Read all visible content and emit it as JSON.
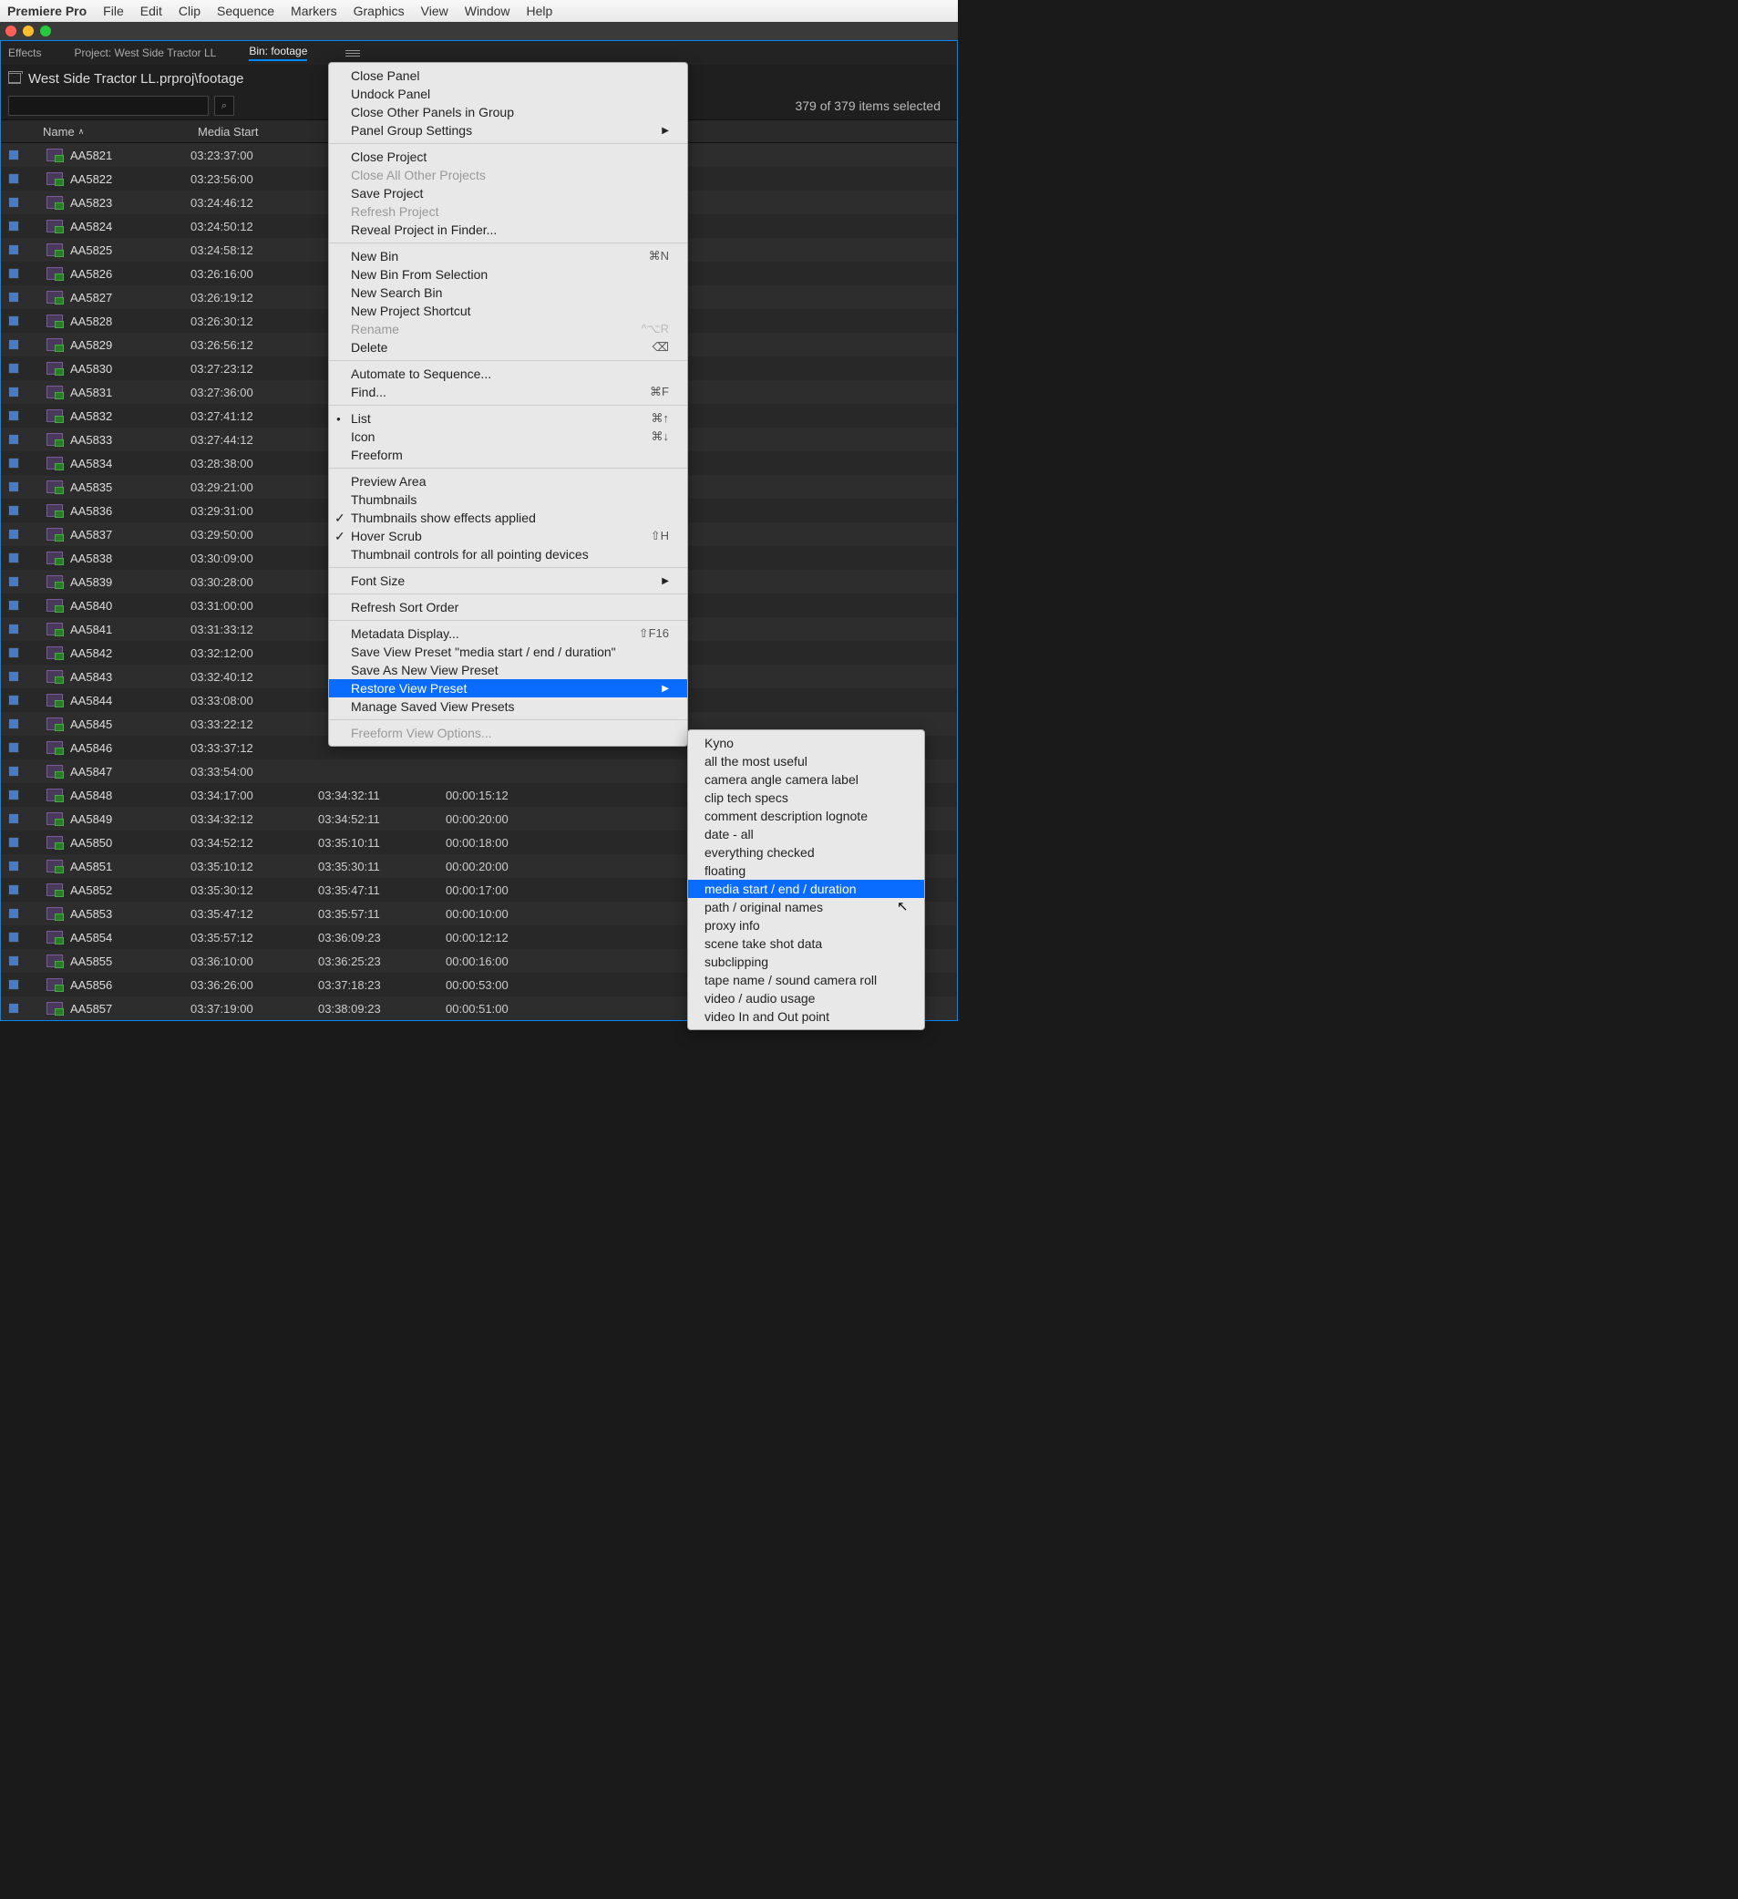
{
  "menubar": {
    "app": "Premiere Pro",
    "items": [
      "File",
      "Edit",
      "Clip",
      "Sequence",
      "Markers",
      "Graphics",
      "View",
      "Window",
      "Help"
    ]
  },
  "panelTabs": {
    "effects": "Effects",
    "project": "Project: West Side Tractor LL",
    "bin": "Bin: footage"
  },
  "breadcrumb": "West Side Tractor LL.prproj\\footage",
  "selectionCount": "379 of 379 items selected",
  "columns": {
    "name": "Name",
    "mediaStart": "Media Start"
  },
  "clips": [
    {
      "name": "AA5821",
      "ms": "03:23:37:00",
      "me": "",
      "md": ""
    },
    {
      "name": "AA5822",
      "ms": "03:23:56:00",
      "me": "",
      "md": ""
    },
    {
      "name": "AA5823",
      "ms": "03:24:46:12",
      "me": "",
      "md": ""
    },
    {
      "name": "AA5824",
      "ms": "03:24:50:12",
      "me": "",
      "md": ""
    },
    {
      "name": "AA5825",
      "ms": "03:24:58:12",
      "me": "",
      "md": ""
    },
    {
      "name": "AA5826",
      "ms": "03:26:16:00",
      "me": "",
      "md": ""
    },
    {
      "name": "AA5827",
      "ms": "03:26:19:12",
      "me": "",
      "md": ""
    },
    {
      "name": "AA5828",
      "ms": "03:26:30:12",
      "me": "",
      "md": ""
    },
    {
      "name": "AA5829",
      "ms": "03:26:56:12",
      "me": "",
      "md": ""
    },
    {
      "name": "AA5830",
      "ms": "03:27:23:12",
      "me": "",
      "md": ""
    },
    {
      "name": "AA5831",
      "ms": "03:27:36:00",
      "me": "",
      "md": ""
    },
    {
      "name": "AA5832",
      "ms": "03:27:41:12",
      "me": "",
      "md": ""
    },
    {
      "name": "AA5833",
      "ms": "03:27:44:12",
      "me": "",
      "md": ""
    },
    {
      "name": "AA5834",
      "ms": "03:28:38:00",
      "me": "",
      "md": ""
    },
    {
      "name": "AA5835",
      "ms": "03:29:21:00",
      "me": "",
      "md": ""
    },
    {
      "name": "AA5836",
      "ms": "03:29:31:00",
      "me": "",
      "md": ""
    },
    {
      "name": "AA5837",
      "ms": "03:29:50:00",
      "me": "",
      "md": ""
    },
    {
      "name": "AA5838",
      "ms": "03:30:09:00",
      "me": "",
      "md": ""
    },
    {
      "name": "AA5839",
      "ms": "03:30:28:00",
      "me": "",
      "md": ""
    },
    {
      "name": "AA5840",
      "ms": "03:31:00:00",
      "me": "",
      "md": ""
    },
    {
      "name": "AA5841",
      "ms": "03:31:33:12",
      "me": "",
      "md": ""
    },
    {
      "name": "AA5842",
      "ms": "03:32:12:00",
      "me": "",
      "md": ""
    },
    {
      "name": "AA5843",
      "ms": "03:32:40:12",
      "me": "",
      "md": ""
    },
    {
      "name": "AA5844",
      "ms": "03:33:08:00",
      "me": "",
      "md": ""
    },
    {
      "name": "AA5845",
      "ms": "03:33:22:12",
      "me": "",
      "md": ""
    },
    {
      "name": "AA5846",
      "ms": "03:33:37:12",
      "me": "",
      "md": ""
    },
    {
      "name": "AA5847",
      "ms": "03:33:54:00",
      "me": "",
      "md": ""
    },
    {
      "name": "AA5848",
      "ms": "03:34:17:00",
      "me": "03:34:32:11",
      "md": "00:00:15:12"
    },
    {
      "name": "AA5849",
      "ms": "03:34:32:12",
      "me": "03:34:52:11",
      "md": "00:00:20:00"
    },
    {
      "name": "AA5850",
      "ms": "03:34:52:12",
      "me": "03:35:10:11",
      "md": "00:00:18:00"
    },
    {
      "name": "AA5851",
      "ms": "03:35:10:12",
      "me": "03:35:30:11",
      "md": "00:00:20:00"
    },
    {
      "name": "AA5852",
      "ms": "03:35:30:12",
      "me": "03:35:47:11",
      "md": "00:00:17:00"
    },
    {
      "name": "AA5853",
      "ms": "03:35:47:12",
      "me": "03:35:57:11",
      "md": "00:00:10:00"
    },
    {
      "name": "AA5854",
      "ms": "03:35:57:12",
      "me": "03:36:09:23",
      "md": "00:00:12:12"
    },
    {
      "name": "AA5855",
      "ms": "03:36:10:00",
      "me": "03:36:25:23",
      "md": "00:00:16:00"
    },
    {
      "name": "AA5856",
      "ms": "03:36:26:00",
      "me": "03:37:18:23",
      "md": "00:00:53:00"
    },
    {
      "name": "AA5857",
      "ms": "03:37:19:00",
      "me": "03:38:09:23",
      "md": "00:00:51:00"
    }
  ],
  "contextMenu": [
    {
      "label": "Close Panel"
    },
    {
      "label": "Undock Panel"
    },
    {
      "label": "Close Other Panels in Group"
    },
    {
      "label": "Panel Group Settings",
      "arrow": true
    },
    {
      "sep": true
    },
    {
      "label": "Close Project"
    },
    {
      "label": "Close All Other Projects",
      "disabled": true
    },
    {
      "label": "Save Project"
    },
    {
      "label": "Refresh Project",
      "disabled": true
    },
    {
      "label": "Reveal Project in Finder..."
    },
    {
      "sep": true
    },
    {
      "label": "New Bin",
      "shortcut": "⌘N"
    },
    {
      "label": "New Bin From Selection"
    },
    {
      "label": "New Search Bin"
    },
    {
      "label": "New Project Shortcut"
    },
    {
      "label": "Rename",
      "shortcut": "^⌥R",
      "disabled": true
    },
    {
      "label": "Delete",
      "shortcut": "⌫"
    },
    {
      "sep": true
    },
    {
      "label": "Automate to Sequence..."
    },
    {
      "label": "Find...",
      "shortcut": "⌘F"
    },
    {
      "sep": true
    },
    {
      "label": "List",
      "shortcut": "⌘↑",
      "bullet": true
    },
    {
      "label": "Icon",
      "shortcut": "⌘↓"
    },
    {
      "label": "Freeform"
    },
    {
      "sep": true
    },
    {
      "label": "Preview Area"
    },
    {
      "label": "Thumbnails"
    },
    {
      "label": "Thumbnails show effects applied",
      "check": true
    },
    {
      "label": "Hover Scrub",
      "shortcut": "⇧H",
      "check": true
    },
    {
      "label": "Thumbnail controls for all pointing devices"
    },
    {
      "sep": true
    },
    {
      "label": "Font Size",
      "arrow": true
    },
    {
      "sep": true
    },
    {
      "label": "Refresh Sort Order"
    },
    {
      "sep": true
    },
    {
      "label": "Metadata Display...",
      "shortcut": "⇧F16"
    },
    {
      "label": "Save View Preset \"media start / end / duration\""
    },
    {
      "label": "Save As New View Preset"
    },
    {
      "label": "Restore View Preset",
      "arrow": true,
      "highlighted": true
    },
    {
      "label": "Manage Saved View Presets"
    },
    {
      "sep": true
    },
    {
      "label": "Freeform View Options...",
      "disabled": true
    }
  ],
  "submenu": [
    {
      "label": "Kyno"
    },
    {
      "label": "all the most useful"
    },
    {
      "label": "camera angle camera label"
    },
    {
      "label": "clip tech specs"
    },
    {
      "label": "comment description lognote"
    },
    {
      "label": "date - all"
    },
    {
      "label": "everything checked"
    },
    {
      "label": "floating"
    },
    {
      "label": "media start / end / duration",
      "highlighted": true
    },
    {
      "label": "path / original names"
    },
    {
      "label": "proxy info"
    },
    {
      "label": "scene take shot data"
    },
    {
      "label": "subclipping"
    },
    {
      "label": "tape name / sound camera roll"
    },
    {
      "label": "video / audio usage"
    },
    {
      "label": "video In and Out point"
    }
  ]
}
